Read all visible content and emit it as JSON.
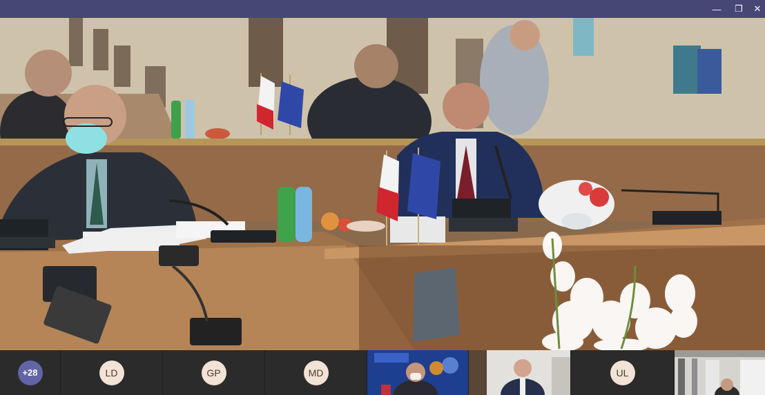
{
  "window": {
    "minimize_icon": "minimize-icon",
    "restore_icon": "restore-icon",
    "close_icon": "close-icon",
    "minimize_glyph": "—",
    "restore_glyph": "❐",
    "close_glyph": "✕"
  },
  "main_video": {
    "scene": "meeting-room-video"
  },
  "participants": {
    "overflow_count": "+28",
    "tiles": [
      {
        "initials": "LD"
      },
      {
        "initials": "GP"
      },
      {
        "initials": "MD"
      },
      {
        "initials": "UL"
      }
    ]
  },
  "colors": {
    "titlebar": "#464775",
    "overflow_badge": "#6264a7",
    "avatar_bg": "#f3e3d6",
    "strip_bg": "#2b2b2b"
  }
}
